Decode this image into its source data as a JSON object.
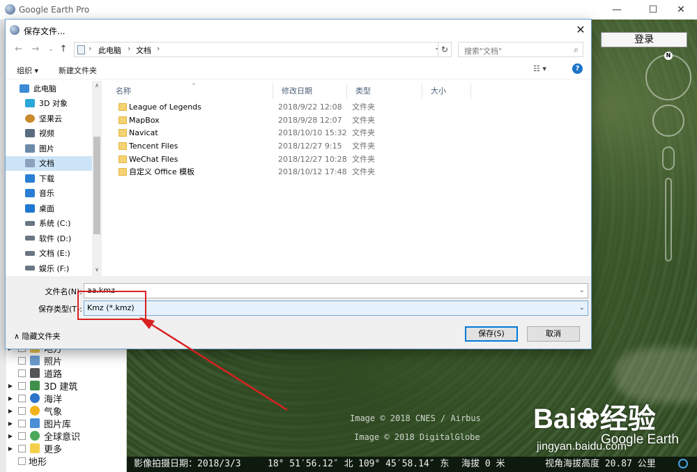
{
  "app": {
    "title": "Google Earth Pro",
    "window_controls": {
      "minimize": "—",
      "maximize": "☐",
      "close": "✕"
    },
    "login_button": "登录",
    "compass_letter": "N"
  },
  "layers": [
    {
      "label": "地方",
      "icon": "places-icon"
    },
    {
      "label": "照片",
      "icon": "photos-icon"
    },
    {
      "label": "道路",
      "icon": "roads-icon"
    },
    {
      "label": "3D 建筑",
      "icon": "3d-buildings-icon"
    },
    {
      "label": "海洋",
      "icon": "ocean-icon"
    },
    {
      "label": "气象",
      "icon": "weather-icon"
    },
    {
      "label": "图片库",
      "icon": "gallery-icon"
    },
    {
      "label": "全球意识",
      "icon": "global-awareness-icon"
    },
    {
      "label": "更多",
      "icon": "more-icon"
    },
    {
      "label": "地形",
      "icon": "terrain-icon"
    }
  ],
  "map": {
    "credit_1": "Image © 2018 CNES / Airbus",
    "credit_2": "Image © 2018 DigitalGlobe",
    "watermark_sub": "jingyan.baidu.com",
    "google_earth_mark": "Google Earth"
  },
  "status_bar": {
    "capture_date": "影像拍摄日期：2018/3/3",
    "lat": "18° 51′56.12″ 北",
    "lon": "109° 45′58.14″ 东",
    "elevation": "海拔      0 米",
    "eye_alt": "视角海拔高度  20.87 公里"
  },
  "dialog": {
    "title": "保存文件...",
    "close": "✕",
    "nav": {
      "back": "←",
      "forward": "→",
      "recent": "⌄",
      "up": "↑"
    },
    "breadcrumb": [
      "此电脑",
      "文档"
    ],
    "refresh": "↻",
    "search_placeholder": "搜索\"文档\"",
    "toolbar": {
      "organize": "组织 ▾",
      "new_folder": "新建文件夹",
      "view": "☷ ▾",
      "help": "?"
    },
    "tree": [
      {
        "label": "此电脑",
        "color": "#3b8bd6",
        "indent": 0
      },
      {
        "label": "3D 对象",
        "color": "#2aa7d8",
        "indent": 1
      },
      {
        "label": "坚果云",
        "color": "#c98b2e",
        "indent": 1
      },
      {
        "label": "视频",
        "color": "#5a6d80",
        "indent": 1
      },
      {
        "label": "图片",
        "color": "#6b8aa8",
        "indent": 1
      },
      {
        "label": "文档",
        "color": "#8aa2bb",
        "indent": 1,
        "selected": true
      },
      {
        "label": "下载",
        "color": "#2a7fd4",
        "indent": 1
      },
      {
        "label": "音乐",
        "color": "#2a7fd4",
        "indent": 1
      },
      {
        "label": "桌面",
        "color": "#1f79d0",
        "indent": 1
      },
      {
        "label": "系统 (C:)",
        "color": "#6a7684",
        "indent": 1
      },
      {
        "label": "软件 (D:)",
        "color": "#6a7684",
        "indent": 1
      },
      {
        "label": "文档 (E:)",
        "color": "#6a7684",
        "indent": 1
      },
      {
        "label": "娱乐 (F:)",
        "color": "#6a7684",
        "indent": 1
      }
    ],
    "columns": {
      "name": "名称",
      "modified": "修改日期",
      "type": "类型",
      "size": "大小"
    },
    "files": [
      {
        "name": "League of Legends",
        "modified": "2018/9/22 12:08",
        "type": "文件夹"
      },
      {
        "name": "MapBox",
        "modified": "2018/9/28 12:07",
        "type": "文件夹"
      },
      {
        "name": "Navicat",
        "modified": "2018/10/10 15:32",
        "type": "文件夹"
      },
      {
        "name": "Tencent Files",
        "modified": "2018/12/27 9:15",
        "type": "文件夹"
      },
      {
        "name": "WeChat Files",
        "modified": "2018/12/27 10:28",
        "type": "文件夹"
      },
      {
        "name": "自定义 Office 模板",
        "modified": "2018/10/12 17:48",
        "type": "文件夹"
      }
    ],
    "filename_label": "文件名(N):",
    "filename_value": "aa.kmz",
    "filetype_label": "保存类型(T):",
    "filetype_value": "Kmz (*.kmz)",
    "hide_folders": "∧  隐藏文件夹",
    "save_button": "保存(S)",
    "cancel_button": "取消"
  },
  "colors": {
    "accent": "#0078d7",
    "annotation_red": "#d92020",
    "selected_row": "#cce4f7"
  }
}
